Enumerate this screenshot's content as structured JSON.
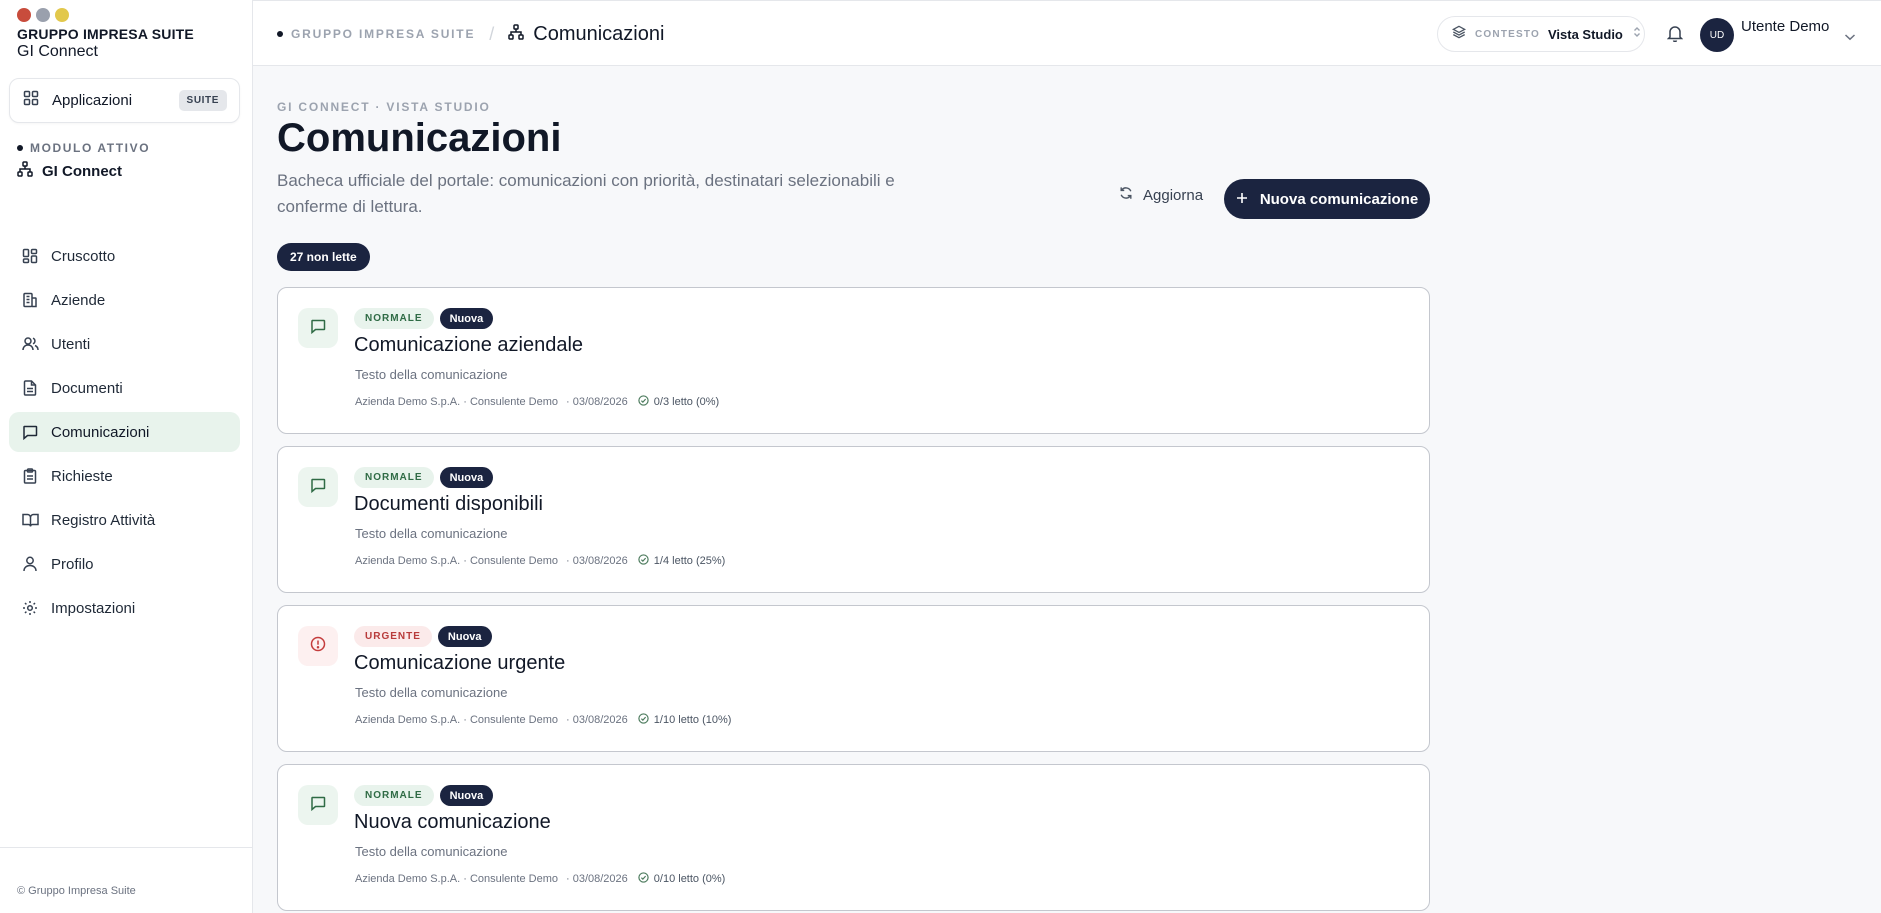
{
  "window": {
    "controls": [
      "#c84c3c",
      "#9aa0ad",
      "#e2c84c"
    ]
  },
  "sidebar": {
    "brand_top": "GRUPPO IMPRESA SUITE",
    "brand_name": "GI Connect",
    "apps_label": "Applicazioni",
    "apps_badge": "SUITE",
    "module_label": "MODULO ATTIVO",
    "module_name": "GI Connect",
    "items": [
      {
        "label": "Cruscotto",
        "icon": "dashboard-icon",
        "active": false
      },
      {
        "label": "Aziende",
        "icon": "building-icon",
        "active": false
      },
      {
        "label": "Utenti",
        "icon": "users-icon",
        "active": false
      },
      {
        "label": "Documenti",
        "icon": "document-icon",
        "active": false
      },
      {
        "label": "Comunicazioni",
        "icon": "message-icon",
        "active": true
      },
      {
        "label": "Richieste",
        "icon": "clipboard-icon",
        "active": false
      },
      {
        "label": "Registro Attività",
        "icon": "book-icon",
        "active": false
      },
      {
        "label": "Profilo",
        "icon": "user-icon",
        "active": false
      },
      {
        "label": "Impostazioni",
        "icon": "gear-icon",
        "active": false
      }
    ],
    "footer": "© Gruppo Impresa Suite"
  },
  "header": {
    "breadcrumb_root": "GRUPPO IMPRESA SUITE",
    "breadcrumb_sep": "/",
    "breadcrumb_current": "Comunicazioni",
    "context_key": "CONTESTO",
    "context_value": "Vista Studio",
    "avatar_initials": "UD",
    "user_name": "Utente Demo"
  },
  "main": {
    "eyebrow": "GI CONNECT · VISTA STUDIO",
    "title": "Comunicazioni",
    "description": "Bacheca ufficiale del portale: comunicazioni con priorità, destinatari selezionabili e conferme di lettura.",
    "refresh_label": "Aggiorna",
    "new_label": "Nuova comunicazione",
    "unread_badge": "27 non lette"
  },
  "communications": [
    {
      "priority": "NORMALE",
      "urgent": false,
      "status": "Nuova",
      "title": "Comunicazione aziendale",
      "body": "Testo della comunicazione",
      "meta": "Azienda Demo S.p.A. · Consulente Demo",
      "date": "· 03/08/2026",
      "read": "0/3 letto (0%)"
    },
    {
      "priority": "NORMALE",
      "urgent": false,
      "status": "Nuova",
      "title": "Documenti disponibili",
      "body": "Testo della comunicazione",
      "meta": "Azienda Demo S.p.A. · Consulente Demo",
      "date": "· 03/08/2026",
      "read": "1/4 letto (25%)"
    },
    {
      "priority": "URGENTE",
      "urgent": true,
      "status": "Nuova",
      "title": "Comunicazione urgente",
      "body": "Testo della comunicazione",
      "meta": "Azienda Demo S.p.A. · Consulente Demo",
      "date": "· 03/08/2026",
      "read": "1/10 letto (10%)"
    },
    {
      "priority": "NORMALE",
      "urgent": false,
      "status": "Nuova",
      "title": "Nuova comunicazione",
      "body": "Testo della comunicazione",
      "meta": "Azienda Demo S.p.A. · Consulente Demo",
      "date": "· 03/08/2026",
      "read": "0/10 letto (0%)"
    }
  ],
  "colors": {
    "navy": "#1b2440",
    "active_bg": "#e8f3ec",
    "normal_tag": "#2f6b45",
    "urgent_tag": "#b83b3b"
  }
}
